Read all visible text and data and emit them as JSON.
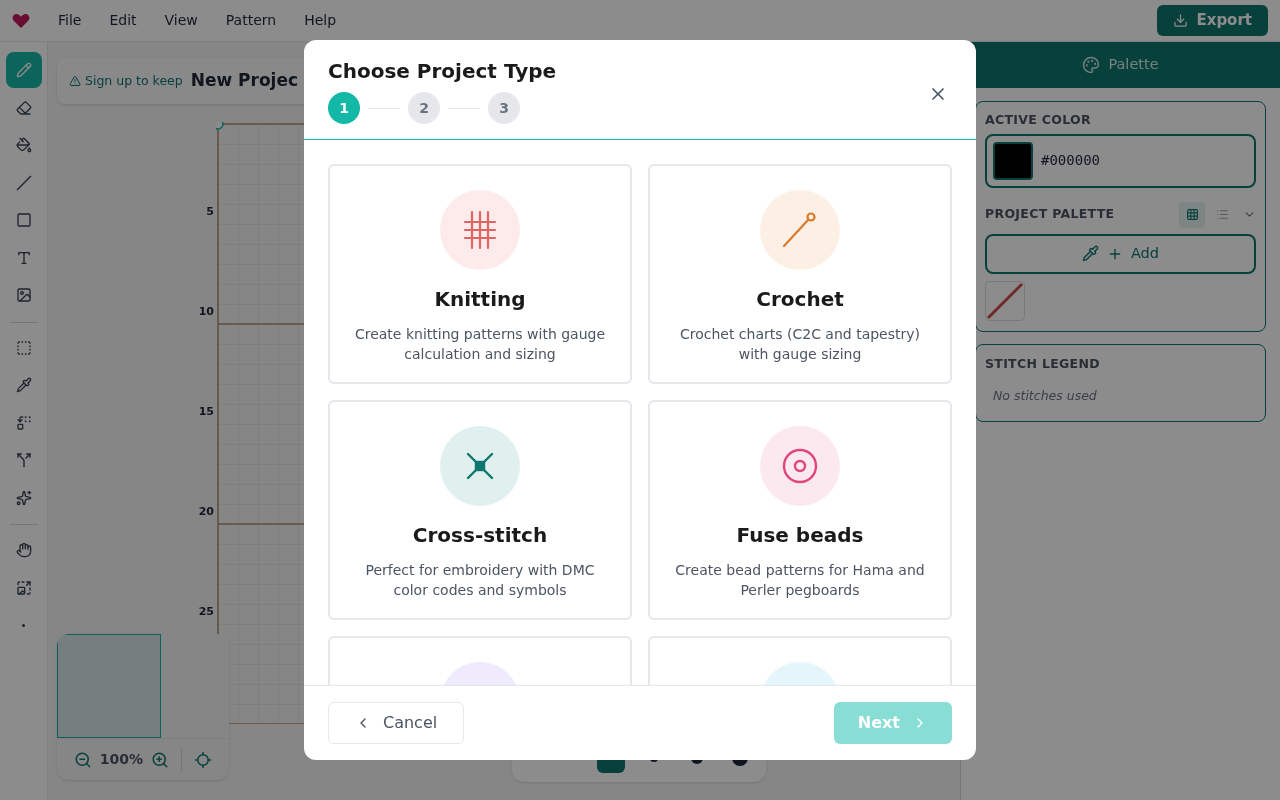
{
  "menu": [
    "File",
    "Edit",
    "View",
    "Pattern",
    "Help"
  ],
  "export_button": "Export",
  "tool_groups": [
    [
      {
        "selected": true
      },
      {
        "selected": false
      },
      {
        "selected": false
      },
      {
        "selected": false
      },
      {
        "selected": false
      },
      {
        "selected": false
      },
      {
        "selected": false
      }
    ],
    [
      {
        "selected": false
      },
      {
        "selected": false
      },
      {
        "selected": false
      },
      {
        "selected": false
      },
      {
        "selected": false
      }
    ],
    [
      {
        "selected": false
      },
      {
        "selected": false
      },
      {
        "selected": false
      }
    ]
  ],
  "canvas": {
    "signup_link": "Sign up to keep",
    "project_title": "New Projec",
    "row_numbers": [
      "5",
      "10",
      "15",
      "20",
      "25"
    ]
  },
  "zoom": {
    "reading": "100%"
  },
  "brush_bar": {
    "sizes": [
      {
        "selected": true
      },
      {
        "selected": false
      },
      {
        "selected": false
      },
      {
        "selected": false
      }
    ]
  },
  "right_panel": {
    "tab": "Palette",
    "active_color": {
      "heading": "ACTIVE COLOR",
      "value": "#000000",
      "color": "#000000"
    },
    "project_palette": {
      "heading": "PROJECT PALETTE",
      "view_buttons": [
        {
          "selected": true
        },
        {
          "selected": false
        }
      ],
      "add_button": "Add"
    },
    "stitch_legend": {
      "heading": "STITCH LEGEND",
      "empty": "No stitches used"
    }
  },
  "dialog": {
    "title": "Choose Project Type",
    "steps": [
      {
        "label": "1",
        "selected": true
      },
      {
        "label": "2",
        "selected": false
      },
      {
        "label": "3",
        "selected": false
      }
    ],
    "cards": [
      {
        "kind": "knitting",
        "color": "#fdeaea",
        "title": "Knitting",
        "description": "Create knitting patterns with gauge calculation and sizing"
      },
      {
        "kind": "crochet",
        "color": "#fcefe4",
        "title": "Crochet",
        "description": "Crochet charts (C2C and tapestry) with gauge sizing"
      },
      {
        "kind": "cross-stitch",
        "color": "#e0f0ee",
        "title": "Cross-stitch",
        "description": "Perfect for embroidery with DMC color codes and symbols"
      },
      {
        "kind": "beads",
        "color": "#fce8ef",
        "title": "Fuse beads",
        "description": "Create bead patterns for Hama and Perler pegboards"
      },
      {
        "kind": "partial",
        "color": "#efeafe"
      },
      {
        "kind": "partial",
        "color": "#e4f5fb"
      }
    ],
    "cancel_button": "Cancel",
    "next_button": {
      "label": "Next",
      "disabled": true
    }
  }
}
